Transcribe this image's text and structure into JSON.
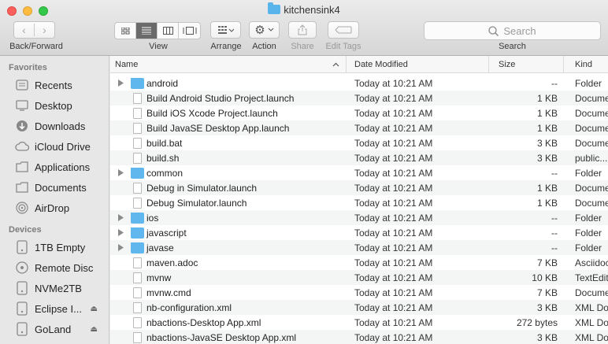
{
  "window": {
    "title": "kitchensink4"
  },
  "toolbar": {
    "back_forward_label": "Back/Forward",
    "view_label": "View",
    "arrange_label": "Arrange",
    "action_label": "Action",
    "share_label": "Share",
    "edit_tags_label": "Edit Tags",
    "search_label": "Search",
    "search_placeholder": "Search"
  },
  "sidebar": {
    "favorites_heading": "Favorites",
    "favorites": [
      {
        "label": "Recents",
        "icon": "recents-icon"
      },
      {
        "label": "Desktop",
        "icon": "desktop-icon"
      },
      {
        "label": "Downloads",
        "icon": "downloads-icon"
      },
      {
        "label": "iCloud Drive",
        "icon": "cloud-icon"
      },
      {
        "label": "Applications",
        "icon": "applications-icon"
      },
      {
        "label": "Documents",
        "icon": "documents-icon"
      },
      {
        "label": "AirDrop",
        "icon": "airdrop-icon"
      }
    ],
    "devices_heading": "Devices",
    "devices": [
      {
        "label": "1TB Empty",
        "icon": "drive-icon"
      },
      {
        "label": "Remote Disc",
        "icon": "disc-icon"
      },
      {
        "label": "NVMe2TB",
        "icon": "drive-icon"
      },
      {
        "label": "Eclipse I...",
        "icon": "drive-icon",
        "eject": true
      },
      {
        "label": "GoLand",
        "icon": "drive-icon",
        "eject": true
      }
    ]
  },
  "columns": {
    "name": "Name",
    "date": "Date Modified",
    "size": "Size",
    "kind": "Kind"
  },
  "files": [
    {
      "name": "android",
      "folder": true,
      "date": "Today at 10:21 AM",
      "size": "--",
      "kind": "Folder"
    },
    {
      "name": "Build Android Studio Project.launch",
      "folder": false,
      "date": "Today at 10:21 AM",
      "size": "1 KB",
      "kind": "Docume"
    },
    {
      "name": "Build iOS Xcode Project.launch",
      "folder": false,
      "date": "Today at 10:21 AM",
      "size": "1 KB",
      "kind": "Docume"
    },
    {
      "name": "Build JavaSE Desktop App.launch",
      "folder": false,
      "date": "Today at 10:21 AM",
      "size": "1 KB",
      "kind": "Docume"
    },
    {
      "name": "build.bat",
      "folder": false,
      "date": "Today at 10:21 AM",
      "size": "3 KB",
      "kind": "Docume"
    },
    {
      "name": "build.sh",
      "folder": false,
      "date": "Today at 10:21 AM",
      "size": "3 KB",
      "kind": "public..."
    },
    {
      "name": "common",
      "folder": true,
      "date": "Today at 10:21 AM",
      "size": "--",
      "kind": "Folder"
    },
    {
      "name": "Debug in Simulator.launch",
      "folder": false,
      "date": "Today at 10:21 AM",
      "size": "1 KB",
      "kind": "Docume"
    },
    {
      "name": "Debug Simulator.launch",
      "folder": false,
      "date": "Today at 10:21 AM",
      "size": "1 KB",
      "kind": "Docume"
    },
    {
      "name": "ios",
      "folder": true,
      "date": "Today at 10:21 AM",
      "size": "--",
      "kind": "Folder"
    },
    {
      "name": "javascript",
      "folder": true,
      "date": "Today at 10:21 AM",
      "size": "--",
      "kind": "Folder"
    },
    {
      "name": "javase",
      "folder": true,
      "date": "Today at 10:21 AM",
      "size": "--",
      "kind": "Folder"
    },
    {
      "name": "maven.adoc",
      "folder": false,
      "date": "Today at 10:21 AM",
      "size": "7 KB",
      "kind": "Asciidoc"
    },
    {
      "name": "mvnw",
      "folder": false,
      "date": "Today at 10:21 AM",
      "size": "10 KB",
      "kind": "TextEdit"
    },
    {
      "name": "mvnw.cmd",
      "folder": false,
      "date": "Today at 10:21 AM",
      "size": "7 KB",
      "kind": "Docume"
    },
    {
      "name": "nb-configuration.xml",
      "folder": false,
      "date": "Today at 10:21 AM",
      "size": "3 KB",
      "kind": "XML Do"
    },
    {
      "name": "nbactions-Desktop App.xml",
      "folder": false,
      "date": "Today at 10:21 AM",
      "size": "272 bytes",
      "kind": "XML Do"
    },
    {
      "name": "nbactions-JavaSE Desktop App.xml",
      "folder": false,
      "date": "Today at 10:21 AM",
      "size": "3 KB",
      "kind": "XML Do"
    }
  ]
}
